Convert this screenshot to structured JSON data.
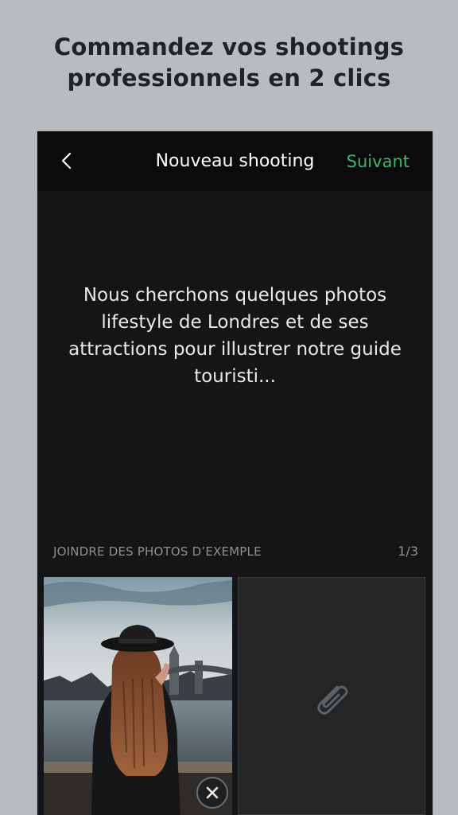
{
  "headline": {
    "line1": "Commandez vos shootings",
    "line2": "professionnels en 2 clics"
  },
  "navbar": {
    "back_icon": "chevron-left-icon",
    "title": "Nouveau shooting",
    "next_label": "Suivant"
  },
  "brief": {
    "text": "Nous cherchons quelques photos lifestyle de Londres et de ses attractions pour illustrer notre guide touristi..."
  },
  "attachments": {
    "label": "JOINDRE DES PHOTOS D’EXEMPLE",
    "count": "1/3",
    "remove_icon": "close-icon",
    "attach_icon": "paperclip-icon"
  },
  "colors": {
    "accent": "#3fb46b",
    "background": "#b9bcbf",
    "screen": "#141517",
    "navbar": "#0b0b0c"
  }
}
